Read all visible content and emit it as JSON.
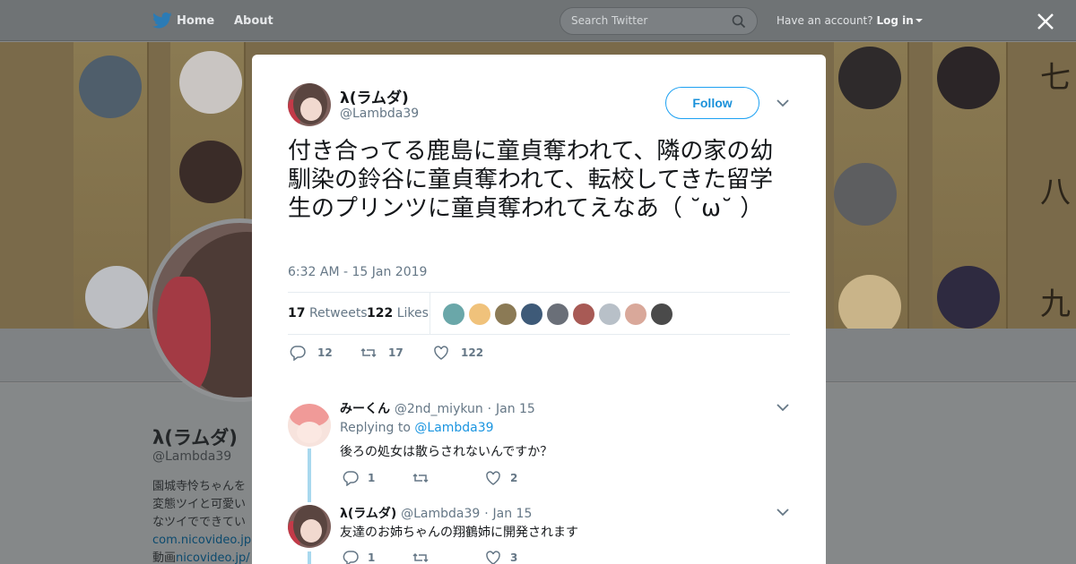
{
  "topnav": {
    "home_label": "Home",
    "about_label": "About",
    "search_placeholder": "Search Twitter",
    "account_prompt": "Have an account?",
    "login_label": "Log in"
  },
  "banner": {
    "kanji": [
      "七",
      "八",
      "九"
    ]
  },
  "profile": {
    "name": "λ(ラムダ)",
    "handle": "@Lambda39",
    "bio_lines": [
      "園城寺怜ちゃんを",
      "変態ツイと可愛い",
      "なツイでできてい"
    ],
    "links": [
      "com.nicovideo.jp/c",
      "nicovideo.jp/"
    ],
    "link_prefix": "動画"
  },
  "tweet": {
    "author_name": "λ(ラムダ)",
    "author_handle": "@Lambda39",
    "follow_label": "Follow",
    "text": "付き合ってる鹿島に童貞奪われて、隣の家の幼馴染の鈴谷に童貞奪われて、転校してきた留学生のプリンツに童貞奪われてえなあ（ ˘ω˘ ）",
    "timestamp": "6:32 AM - 15 Jan 2019",
    "retweets_count": "17",
    "retweets_label": "Retweets",
    "likes_count": "122",
    "likes_label": "Likes",
    "action_counts": {
      "replies": "12",
      "retweets": "17",
      "likes": "122"
    }
  },
  "replies": [
    {
      "name": "みーくん",
      "handle": "@2nd_miykun",
      "date": "Jan 15",
      "replying_to_label": "Replying to",
      "replying_to": "@Lambda39",
      "text": "後ろの処女は散らされないんですか？",
      "counts": {
        "replies": "1",
        "retweets": "",
        "likes": "2"
      }
    },
    {
      "name": "λ(ラムダ)",
      "handle": "@Lambda39",
      "date": "Jan 15",
      "text": "友達のお姉ちゃんの翔鶴姉に開発されます",
      "counts": {
        "replies": "1",
        "retweets": "",
        "likes": "3"
      }
    }
  ],
  "colors": {
    "accent": "#1da1f2",
    "link": "#1b95e0",
    "text": "#14171a",
    "muted": "#657786",
    "thread_line": "#a8d8ee"
  },
  "icons": [
    "twitter-bird-icon",
    "search-icon",
    "close-icon",
    "chevron-down-icon",
    "reply-icon",
    "retweet-icon",
    "heart-icon"
  ]
}
